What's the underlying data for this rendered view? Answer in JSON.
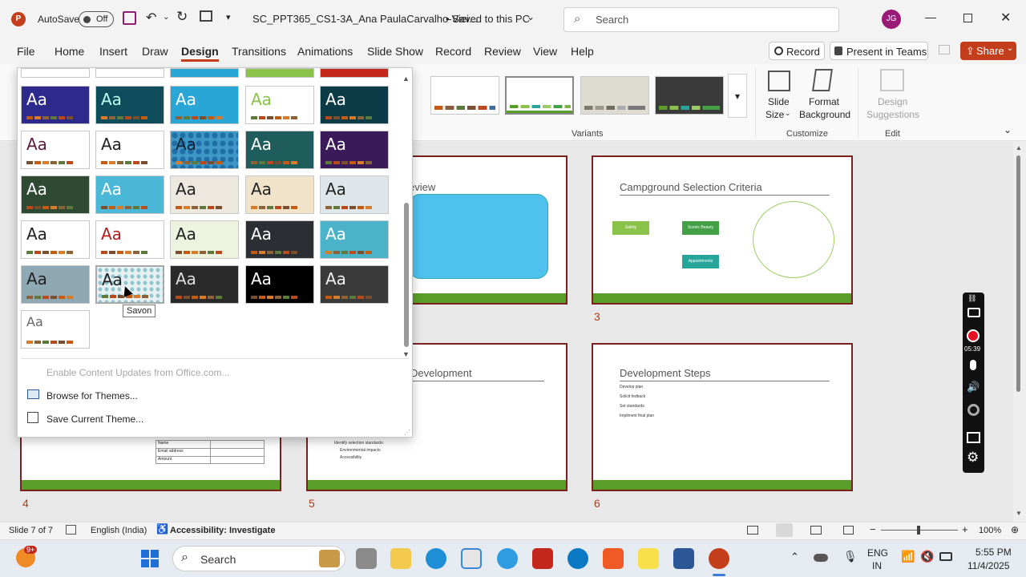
{
  "titlebar": {
    "autosave_label": "AutoSave",
    "autosave_state": "Off",
    "filename": "SC_PPT365_CS1-3A_Ana PaulaCarvalho-Viei...",
    "saved_status": "• Saved to this PC",
    "search_placeholder": "Search",
    "user_initials": "JG"
  },
  "tabs": [
    "File",
    "Home",
    "Insert",
    "Draw",
    "Design",
    "Transitions",
    "Animations",
    "Slide Show",
    "Record",
    "Review",
    "View",
    "Help"
  ],
  "active_tab": "Design",
  "actions": {
    "record": "Record",
    "present_teams": "Present in Teams",
    "share": "Share"
  },
  "ribbon": {
    "variants_label": "Variants",
    "customize_label": "Customize",
    "edit_label": "Edit",
    "slide_size": "Slide\nSize",
    "slide_size_line1": "Slide",
    "slide_size_line2": "Size",
    "format_bg_line1": "Format",
    "format_bg_line2": "Background",
    "design_sugg_line1": "Design",
    "design_sugg_line2": "Suggestions"
  },
  "gallery": {
    "tooltip": "Savon",
    "menu": {
      "enable_updates": "Enable Content Updates from Office.com...",
      "browse": "Browse for Themes...",
      "save": "Save Current Theme..."
    },
    "aa": "Aa"
  },
  "slides": [
    {
      "num": "3",
      "title": "Campground Selection Criteria",
      "boxes": [
        "Safety",
        "Scenic Beauty",
        "Appointments"
      ]
    },
    {
      "num": "4",
      "table_rows": [
        "Name",
        "Email address",
        "Amount"
      ]
    },
    {
      "num": "5",
      "title": "Development",
      "lines": [
        "Identify selection standards:",
        "Environmental impacts",
        "Accessibility"
      ]
    },
    {
      "num": "6",
      "title": "Development Steps",
      "lines": [
        "Develop plan",
        "Solicit fedback",
        "Set standards",
        "Impliment final plan"
      ]
    },
    {
      "num": "",
      "title": "eview"
    }
  ],
  "recorder": {
    "time": "05:39"
  },
  "status": {
    "slide_info": "Slide 7 of 7",
    "language": "English (India)",
    "accessibility": "Accessibility: Investigate",
    "zoom": "100%"
  },
  "taskbar": {
    "search": "Search",
    "badge": "9+",
    "lang1": "ENG",
    "lang2": "IN",
    "time": "5:55 PM",
    "date": "11/4/2025"
  },
  "colors": {
    "accent": "#c43e1c",
    "slide_border": "#7b1f1f",
    "footer_green": "#5a9e2a"
  }
}
